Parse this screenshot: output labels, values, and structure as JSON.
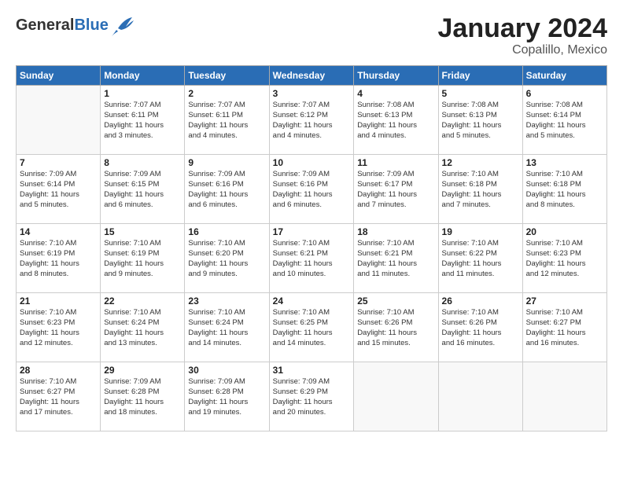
{
  "header": {
    "logo_general": "General",
    "logo_blue": "Blue",
    "title": "January 2024",
    "subtitle": "Copalillo, Mexico"
  },
  "weekdays": [
    "Sunday",
    "Monday",
    "Tuesday",
    "Wednesday",
    "Thursday",
    "Friday",
    "Saturday"
  ],
  "weeks": [
    [
      {
        "day": "",
        "info": ""
      },
      {
        "day": "1",
        "info": "Sunrise: 7:07 AM\nSunset: 6:11 PM\nDaylight: 11 hours\nand 3 minutes."
      },
      {
        "day": "2",
        "info": "Sunrise: 7:07 AM\nSunset: 6:11 PM\nDaylight: 11 hours\nand 4 minutes."
      },
      {
        "day": "3",
        "info": "Sunrise: 7:07 AM\nSunset: 6:12 PM\nDaylight: 11 hours\nand 4 minutes."
      },
      {
        "day": "4",
        "info": "Sunrise: 7:08 AM\nSunset: 6:13 PM\nDaylight: 11 hours\nand 4 minutes."
      },
      {
        "day": "5",
        "info": "Sunrise: 7:08 AM\nSunset: 6:13 PM\nDaylight: 11 hours\nand 5 minutes."
      },
      {
        "day": "6",
        "info": "Sunrise: 7:08 AM\nSunset: 6:14 PM\nDaylight: 11 hours\nand 5 minutes."
      }
    ],
    [
      {
        "day": "7",
        "info": "Sunrise: 7:09 AM\nSunset: 6:14 PM\nDaylight: 11 hours\nand 5 minutes."
      },
      {
        "day": "8",
        "info": "Sunrise: 7:09 AM\nSunset: 6:15 PM\nDaylight: 11 hours\nand 6 minutes."
      },
      {
        "day": "9",
        "info": "Sunrise: 7:09 AM\nSunset: 6:16 PM\nDaylight: 11 hours\nand 6 minutes."
      },
      {
        "day": "10",
        "info": "Sunrise: 7:09 AM\nSunset: 6:16 PM\nDaylight: 11 hours\nand 6 minutes."
      },
      {
        "day": "11",
        "info": "Sunrise: 7:09 AM\nSunset: 6:17 PM\nDaylight: 11 hours\nand 7 minutes."
      },
      {
        "day": "12",
        "info": "Sunrise: 7:10 AM\nSunset: 6:18 PM\nDaylight: 11 hours\nand 7 minutes."
      },
      {
        "day": "13",
        "info": "Sunrise: 7:10 AM\nSunset: 6:18 PM\nDaylight: 11 hours\nand 8 minutes."
      }
    ],
    [
      {
        "day": "14",
        "info": "Sunrise: 7:10 AM\nSunset: 6:19 PM\nDaylight: 11 hours\nand 8 minutes."
      },
      {
        "day": "15",
        "info": "Sunrise: 7:10 AM\nSunset: 6:19 PM\nDaylight: 11 hours\nand 9 minutes."
      },
      {
        "day": "16",
        "info": "Sunrise: 7:10 AM\nSunset: 6:20 PM\nDaylight: 11 hours\nand 9 minutes."
      },
      {
        "day": "17",
        "info": "Sunrise: 7:10 AM\nSunset: 6:21 PM\nDaylight: 11 hours\nand 10 minutes."
      },
      {
        "day": "18",
        "info": "Sunrise: 7:10 AM\nSunset: 6:21 PM\nDaylight: 11 hours\nand 11 minutes."
      },
      {
        "day": "19",
        "info": "Sunrise: 7:10 AM\nSunset: 6:22 PM\nDaylight: 11 hours\nand 11 minutes."
      },
      {
        "day": "20",
        "info": "Sunrise: 7:10 AM\nSunset: 6:23 PM\nDaylight: 11 hours\nand 12 minutes."
      }
    ],
    [
      {
        "day": "21",
        "info": "Sunrise: 7:10 AM\nSunset: 6:23 PM\nDaylight: 11 hours\nand 12 minutes."
      },
      {
        "day": "22",
        "info": "Sunrise: 7:10 AM\nSunset: 6:24 PM\nDaylight: 11 hours\nand 13 minutes."
      },
      {
        "day": "23",
        "info": "Sunrise: 7:10 AM\nSunset: 6:24 PM\nDaylight: 11 hours\nand 14 minutes."
      },
      {
        "day": "24",
        "info": "Sunrise: 7:10 AM\nSunset: 6:25 PM\nDaylight: 11 hours\nand 14 minutes."
      },
      {
        "day": "25",
        "info": "Sunrise: 7:10 AM\nSunset: 6:26 PM\nDaylight: 11 hours\nand 15 minutes."
      },
      {
        "day": "26",
        "info": "Sunrise: 7:10 AM\nSunset: 6:26 PM\nDaylight: 11 hours\nand 16 minutes."
      },
      {
        "day": "27",
        "info": "Sunrise: 7:10 AM\nSunset: 6:27 PM\nDaylight: 11 hours\nand 16 minutes."
      }
    ],
    [
      {
        "day": "28",
        "info": "Sunrise: 7:10 AM\nSunset: 6:27 PM\nDaylight: 11 hours\nand 17 minutes."
      },
      {
        "day": "29",
        "info": "Sunrise: 7:09 AM\nSunset: 6:28 PM\nDaylight: 11 hours\nand 18 minutes."
      },
      {
        "day": "30",
        "info": "Sunrise: 7:09 AM\nSunset: 6:28 PM\nDaylight: 11 hours\nand 19 minutes."
      },
      {
        "day": "31",
        "info": "Sunrise: 7:09 AM\nSunset: 6:29 PM\nDaylight: 11 hours\nand 20 minutes."
      },
      {
        "day": "",
        "info": ""
      },
      {
        "day": "",
        "info": ""
      },
      {
        "day": "",
        "info": ""
      }
    ]
  ]
}
